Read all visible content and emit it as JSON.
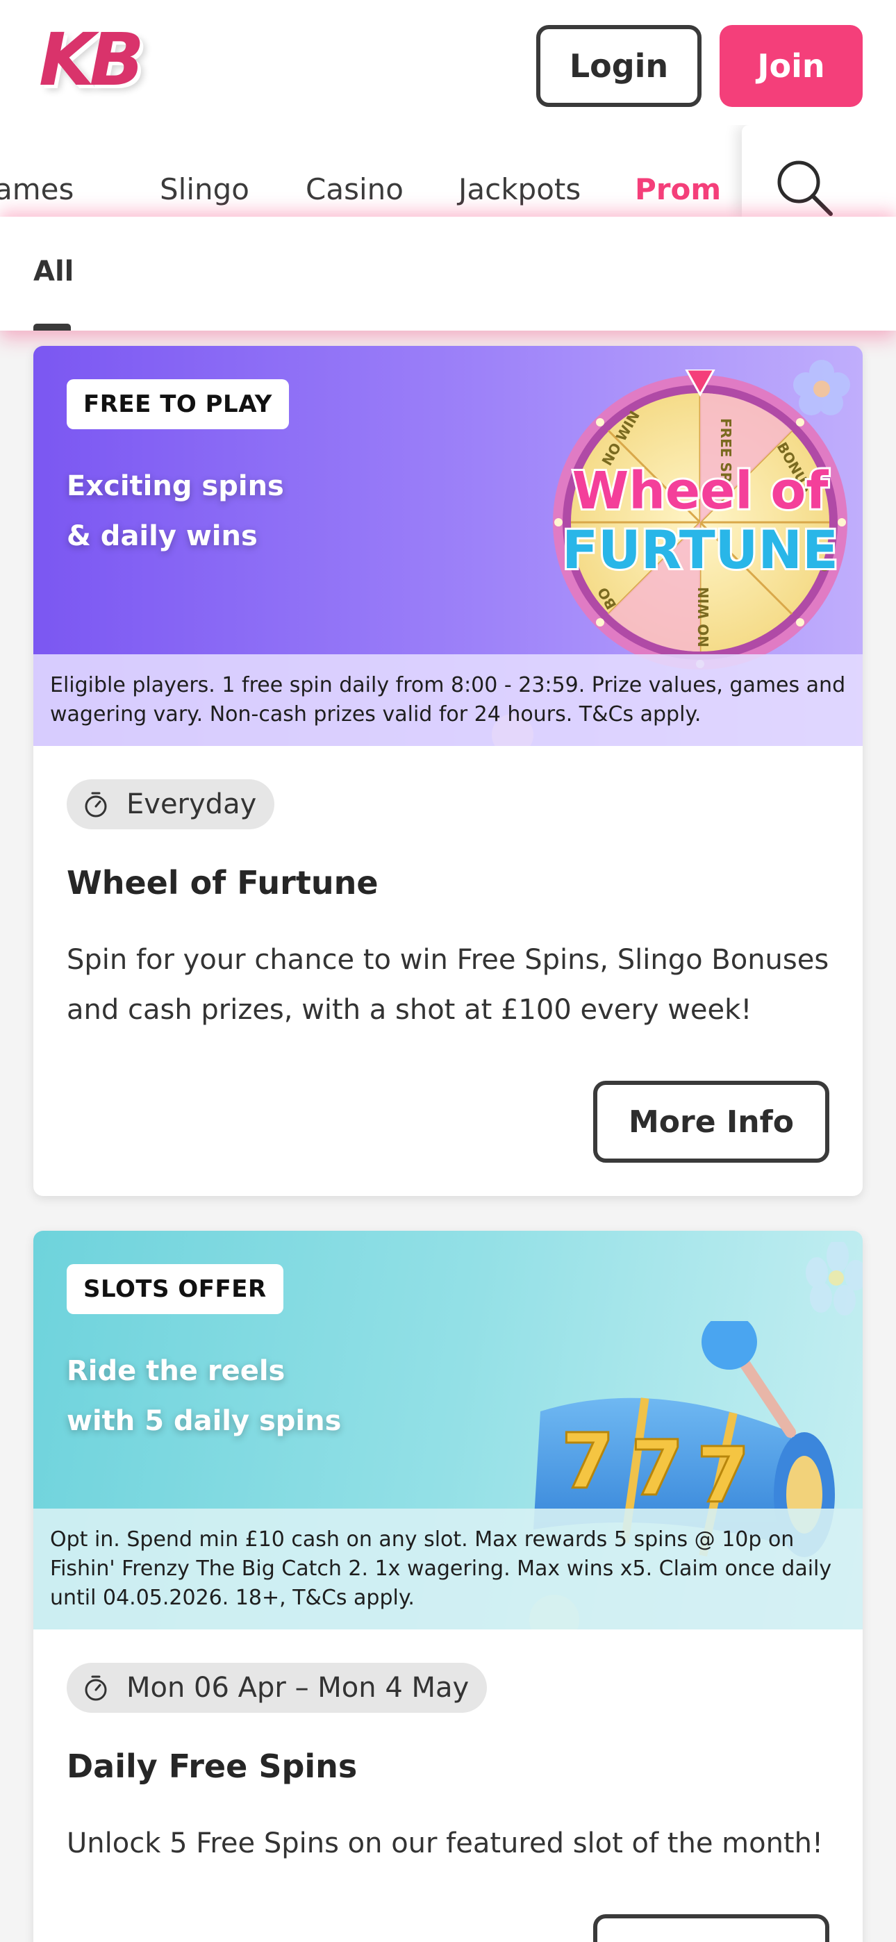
{
  "header": {
    "logo_text": "KB",
    "login_label": "Login",
    "join_label": "Join"
  },
  "nav": {
    "items": [
      {
        "label": "ames"
      },
      {
        "label": "Slingo"
      },
      {
        "label": "Casino"
      },
      {
        "label": "Jackpots"
      },
      {
        "label": "Prom"
      }
    ],
    "active_index": 4,
    "search_icon": "search-icon"
  },
  "filter": {
    "selected": "All"
  },
  "promotions": [
    {
      "tag": "FREE TO PLAY",
      "headline_line1": "Exciting spins",
      "headline_line2": "& daily wins",
      "art_text_line1": "Wheel of",
      "art_text_line2": "FURTUNE",
      "wheel_segments": [
        "FREE SPINS",
        "BONUS",
        "NO WIN",
        "NO WIN",
        "BO",
        "C"
      ],
      "terms": "Eligible players. 1 free spin daily from 8:00 - 23:59. Prize values, games and wagering vary. Non-cash prizes valid for 24 hours. T&Cs apply.",
      "date": "Everyday",
      "title": "Wheel of Furtune",
      "description": "Spin for your chance to win Free Spins, Slingo Bonuses and cash prizes, with a shot at £100 every week!",
      "button_label": "More Info"
    },
    {
      "tag": "SLOTS OFFER",
      "headline_line1": "Ride the reels",
      "headline_line2": "with 5 daily spins",
      "reel_symbols": [
        "7",
        "7",
        "7"
      ],
      "terms": "Opt in. Spend min £10 cash on any slot. Max rewards 5 spins @ 10p on Fishin' Frenzy The Big Catch 2. 1x wagering. Max wins x5. Claim once daily until 04.05.2026. 18+, T&Cs apply.",
      "date": "Mon 06 Apr – Mon 4 May",
      "title": "Daily Free Spins",
      "description": "Unlock 5 Free Spins on our featured slot of the month!",
      "button_label": "More Info"
    }
  ],
  "colors": {
    "brand_pink": "#f43f7a",
    "purple_banner": "#7b57f2",
    "teal_banner": "#6ed3dc"
  }
}
